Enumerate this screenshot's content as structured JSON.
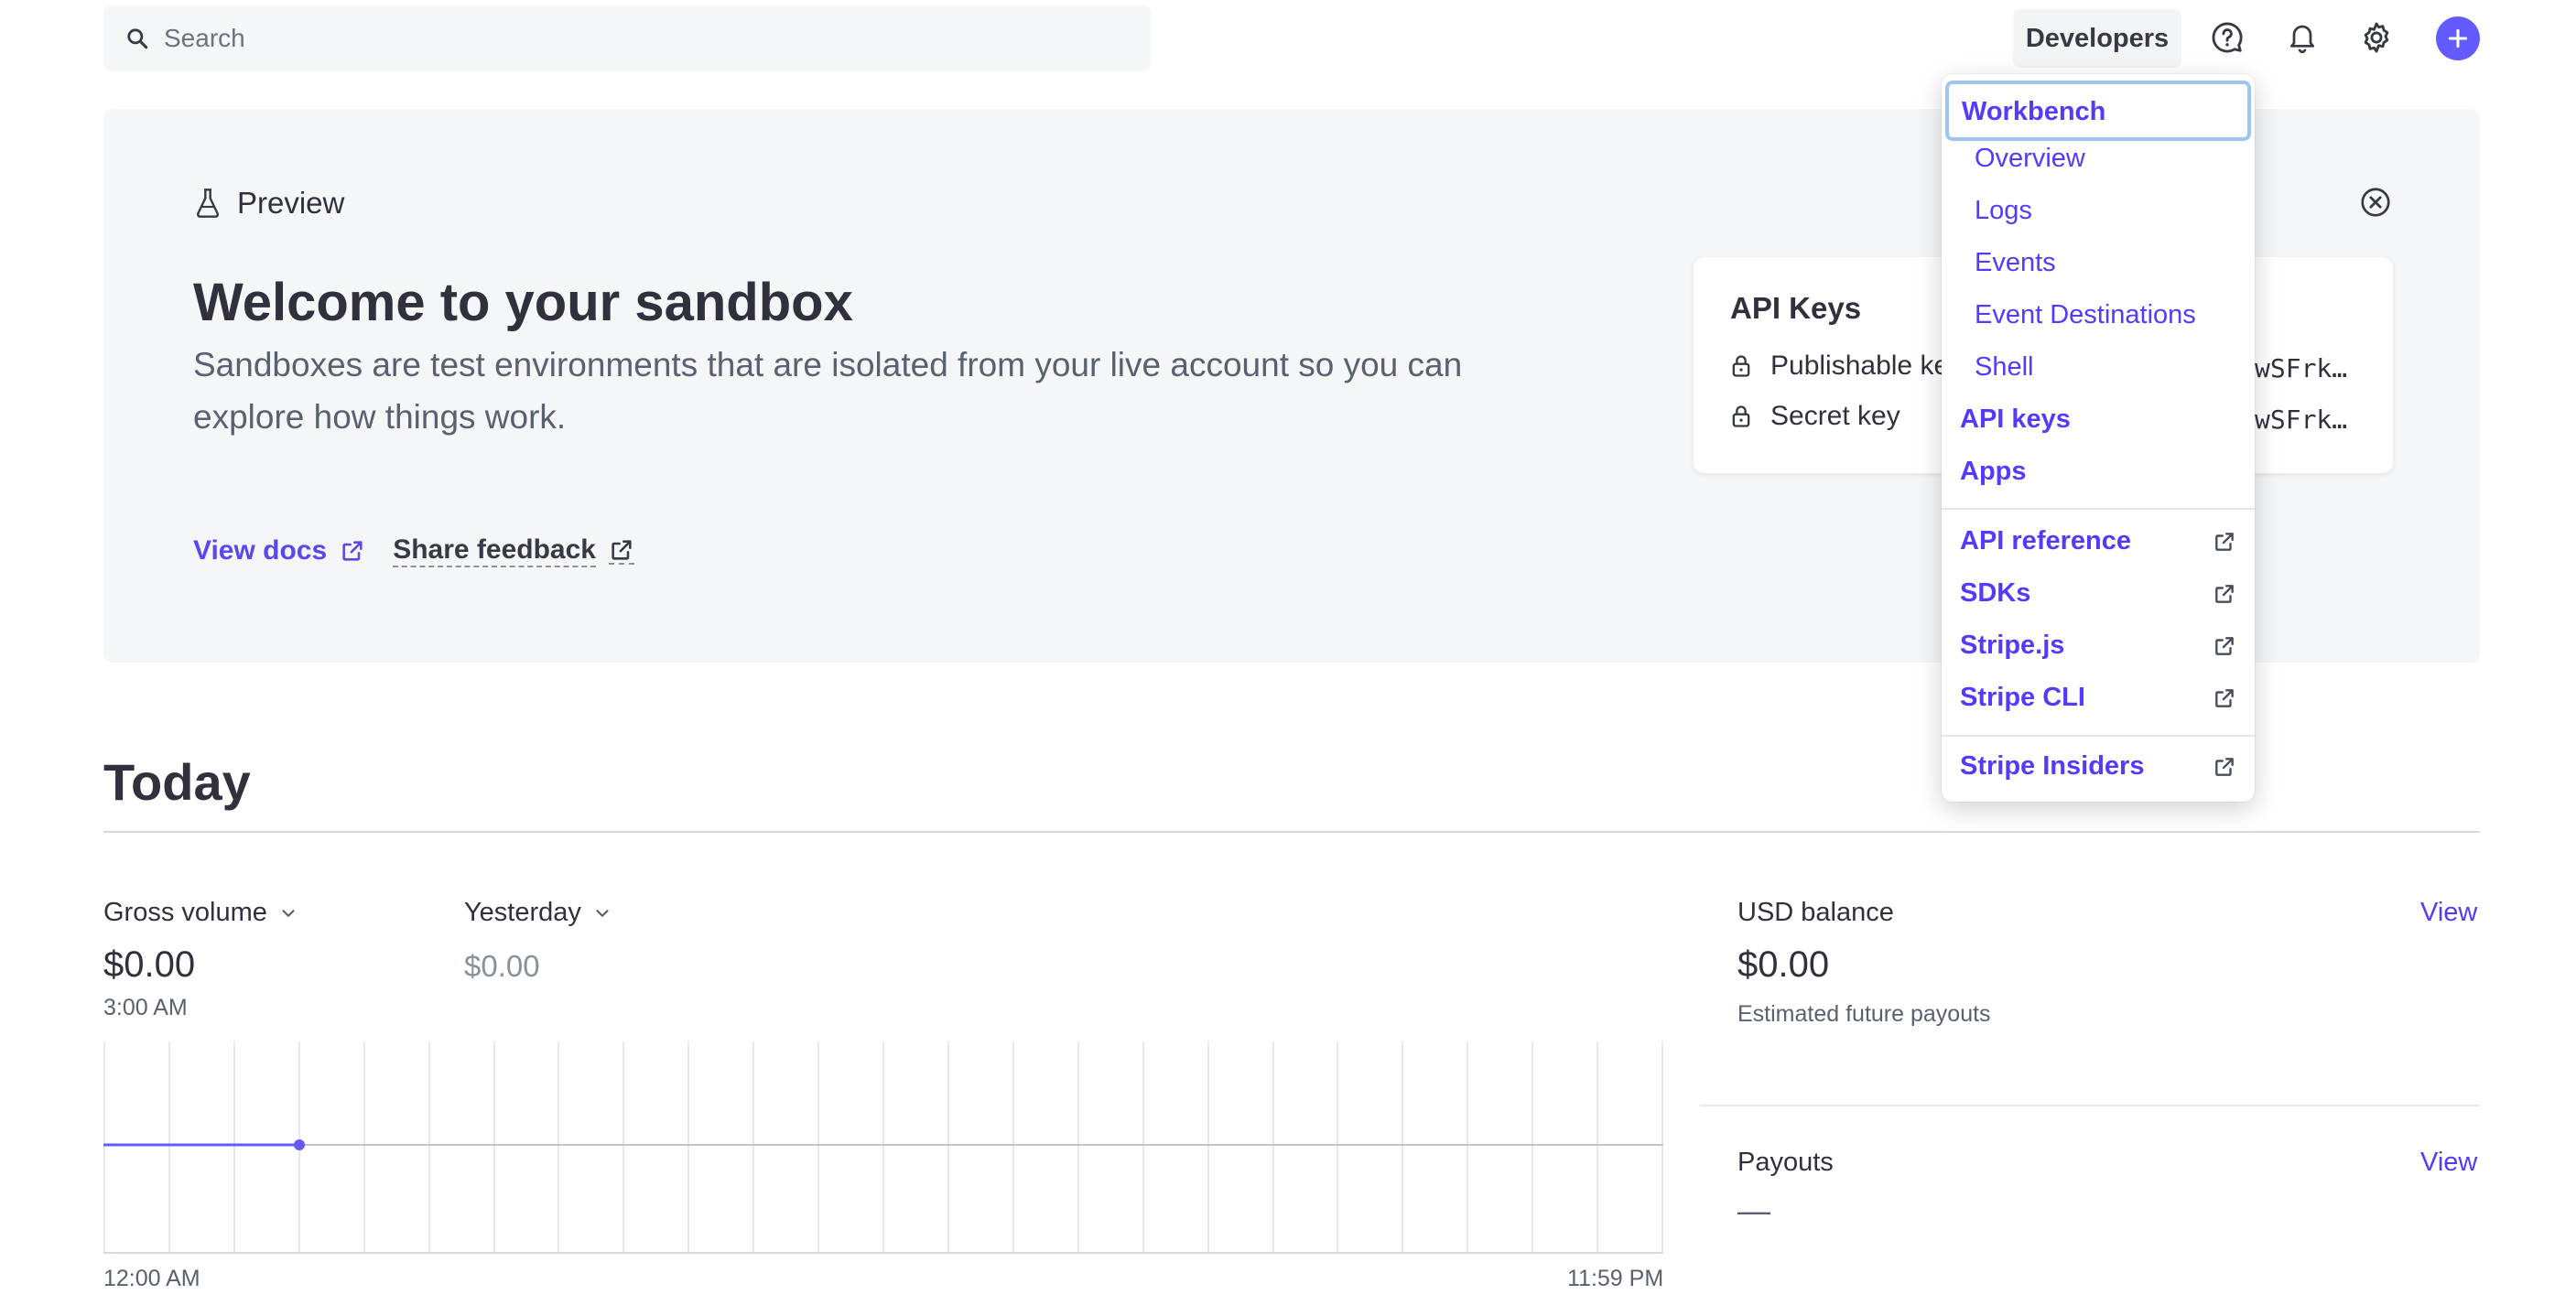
{
  "header": {
    "search_placeholder": "Search",
    "developers_label": "Developers",
    "icons": [
      "search-icon",
      "help-icon",
      "bell-icon",
      "gear-icon",
      "plus-icon"
    ]
  },
  "banner": {
    "preview_label": "Preview",
    "title": "Welcome to your sandbox",
    "description": "Sandboxes are test environments that are isolated from your live account so you can explore how things work.",
    "view_docs": "View docs",
    "share_feedback": "Share feedback"
  },
  "api_keys": {
    "title": "API Keys",
    "publishable_label": "Publishable key",
    "publishable_value": "wSFrk…",
    "secret_label": "Secret key",
    "secret_value": "wSFrk…"
  },
  "dev_menu": {
    "workbench": "Workbench",
    "overview": "Overview",
    "logs": "Logs",
    "events": "Events",
    "event_destinations": "Event Destinations",
    "shell": "Shell",
    "api_keys": "API keys",
    "apps": "Apps",
    "api_reference": "API reference",
    "sdks": "SDKs",
    "stripejs": "Stripe.js",
    "stripe_cli": "Stripe CLI",
    "stripe_insiders": "Stripe Insiders"
  },
  "today": {
    "heading": "Today",
    "gross_volume_label": "Gross volume",
    "gross_volume_value": "$0.00",
    "gross_volume_time": "3:00 AM",
    "compare_label": "Yesterday",
    "compare_value": "$0.00",
    "chart_start": "12:00 AM",
    "chart_end": "11:59 PM",
    "usd_balance_label": "USD balance",
    "usd_balance_value": "$0.00",
    "usd_balance_sub": "Estimated future payouts",
    "payouts_label": "Payouts",
    "payouts_value": "—",
    "view_label": "View"
  },
  "colors": {
    "accent": "#635bff",
    "link": "#533afd",
    "banner_bg": "#f5f6f8"
  }
}
